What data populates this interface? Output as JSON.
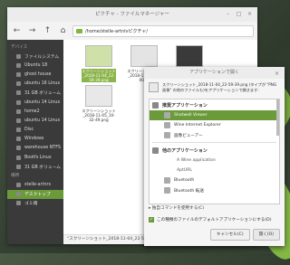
{
  "file_manager": {
    "title": "ピクチャ - ファイルマネージャー",
    "location": "/home/stelle-artnlvピクチャ/",
    "sidebar": {
      "devices_header": "デバイス",
      "devices": [
        "ファイルシステム",
        "Ubuntu 18",
        "ghost house",
        "ubuntu 16 Linux",
        "31 GB ボリューム",
        "ubuntu 14 Linux",
        "home2",
        "ubuntu 14 Linux",
        "Disc",
        "Windows",
        "warehouse NTFS",
        "Bootfs Linux",
        "31 GB ボリューム"
      ],
      "places_header": "場所",
      "places": [
        "stelle-artnrs",
        "デスクトップ",
        "ゴミ箱"
      ]
    },
    "thumbnails": [
      {
        "label": "スクリーンショット_2018-11-04_22-59-39.png"
      },
      {
        "label": "スクリーンショット_2018-11-04_23-00-..."
      },
      {
        "label": "スクリーンショット_2018-11-04_23-45-..."
      },
      {
        "label": "スクリーンショット_2018-11-05_10-32-49.png"
      }
    ],
    "status": "\"スクリーンショット_2018-11-04_22-59-39.png\"..."
  },
  "dialog": {
    "title": "アプリケーションで開く",
    "description": "スクリーンショット_2018-11-04_22-59-39.png (タイプが \"PNG 画像\" の他のファイルも)をアプリケーションで開きます:",
    "recommended_header": "推奨アプリケーション",
    "recommended": [
      "Shotwell Viewer",
      "Wine Internet Explorer",
      "画像ビューアー"
    ],
    "other_header": "他のアプリケーション",
    "other": [
      "A Wine application",
      "AptURL",
      "Bluetooth",
      "Bluetooth 転送"
    ],
    "custom_command": "独自コマンドを使用する(C)",
    "default_checkbox": "この種類のファイルのデフォルトアプリケーションにする(D)",
    "cancel": "キャンセル(C)",
    "open": "開く(O)"
  }
}
